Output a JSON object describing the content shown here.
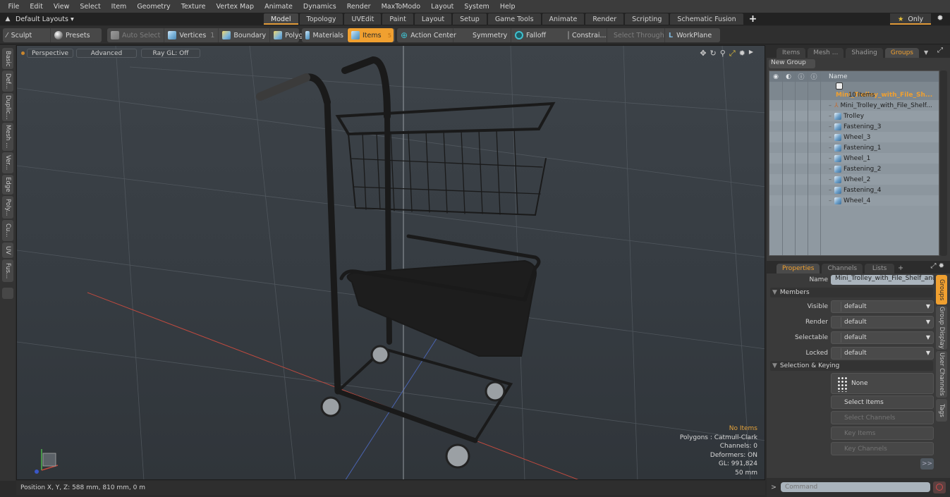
{
  "menu": [
    "File",
    "Edit",
    "View",
    "Select",
    "Item",
    "Geometry",
    "Texture",
    "Vertex Map",
    "Animate",
    "Dynamics",
    "Render",
    "MaxToModo",
    "Layout",
    "System",
    "Help"
  ],
  "layout_bar": {
    "layouts_label": "Default Layouts ▾",
    "tabs": [
      "Model",
      "Topology",
      "UVEdit",
      "Paint",
      "Layout",
      "Setup",
      "Game Tools",
      "Animate",
      "Render",
      "Scripting",
      "Schematic Fusion"
    ],
    "active_tab": "Model",
    "add_tab": "+",
    "only_label": "Only"
  },
  "toolbar": {
    "sculpt": "Sculpt",
    "presets": "Presets",
    "auto_select": "Auto Select",
    "vertices": "Vertices",
    "vertices_count": "1",
    "boundary": "Boundary",
    "polygons": "Polygons",
    "materials": "Materials",
    "items": "Items",
    "items_count": "5",
    "action_center": "Action Center",
    "symmetry": "Symmetry",
    "falloff": "Falloff",
    "constraints": "Constrai...",
    "select_through": "Select Through",
    "workplane": "WorkPlane"
  },
  "left_tabs": [
    "Basic",
    "Def...",
    "Duplic...",
    "Mesh ...",
    "Ver...",
    "Edge",
    "Poly...",
    "Cu...",
    "UV",
    "Fus..."
  ],
  "viewport": {
    "perspective": "Perspective",
    "advanced": "Advanced",
    "raygl": "Ray GL: Off",
    "info": {
      "selection": "No Items",
      "polygons": "Polygons : Catmull-Clark",
      "channels": "Channels: 0",
      "deformers": "Deformers: ON",
      "gl": "GL: 991,824",
      "scale": "50 mm"
    },
    "accent_color": "#e6a33a"
  },
  "status": {
    "position": "Position X, Y, Z:   588 mm, 810 mm, 0 m"
  },
  "groups_panel": {
    "tabs": [
      "Items",
      "Mesh ...",
      "Shading",
      "Groups"
    ],
    "active_tab": "Groups",
    "new_group": "New Group",
    "column_name": "Name",
    "group_name": "Mini_Trolley_with_File_Sh...",
    "group_count": "10 Items",
    "items": [
      "Mini_Trolley_with_File_Shelf...",
      "Trolley",
      "Fastening_3",
      "Wheel_3",
      "Fastening_1",
      "Wheel_1",
      "Fastening_2",
      "Wheel_2",
      "Fastening_4",
      "Wheel_4"
    ]
  },
  "properties_panel": {
    "tabs": [
      "Properties",
      "Channels",
      "Lists"
    ],
    "active_tab": "Properties",
    "add_tab": "+",
    "name_label": "Name",
    "name_value": "Mini_Trolley_with_File_Shelf_and_",
    "members_section": "Members",
    "fields": [
      {
        "label": "Visible",
        "value": "default"
      },
      {
        "label": "Render",
        "value": "default"
      },
      {
        "label": "Selectable",
        "value": "default"
      },
      {
        "label": "Locked",
        "value": "default"
      }
    ],
    "selection_section": "Selection & Keying",
    "none_label": "None",
    "select_items": "Select Items",
    "select_channels": "Select Channels",
    "key_items": "Key Items",
    "key_channels": "Key Channels",
    "more": ">>",
    "side_tabs": [
      "Groups",
      "Group Display",
      "User Channels",
      "Tags"
    ],
    "active_side_tab": "Groups"
  },
  "command": {
    "prompt": ">",
    "placeholder": "Command"
  }
}
